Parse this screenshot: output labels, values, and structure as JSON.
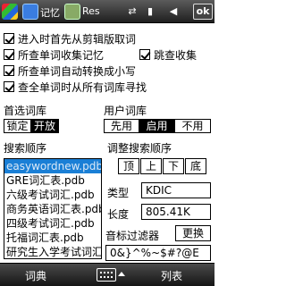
{
  "titlebar": {
    "app1_label": "记忆",
    "app2_label": "Res",
    "ok_label": "ok",
    "icons": [
      "windows-flag-icon",
      "app-icon",
      "app-icon",
      "network-icon",
      "signal-icon",
      "volume-icon"
    ],
    "colors": {
      "bar": "#2a2a2a",
      "text": "#ffffff"
    }
  },
  "options": {
    "enter_first_from_clipboard": "进入时首先从剪辑版取词",
    "record_all_lookups": "所查单词收集记忆",
    "jump_to_collection": "跳查收集",
    "auto_lowercase": "所查单词自动转换成小写",
    "search_all_dicts": "查全单词时从所有词库寻找"
  },
  "preferred_dict": {
    "label": "首选词库",
    "buttons": [
      "锁定",
      "开放"
    ],
    "selected": "开放"
  },
  "user_dict": {
    "label": "用户词库",
    "buttons": [
      "先用",
      "启用",
      "不用"
    ],
    "selected": "启用"
  },
  "search_order": {
    "label": "搜索顺序",
    "items": [
      "easywordnew.pdb",
      "GRE词汇表.pdb",
      "六级考试词汇.pdb",
      "商务英语词汇表.pdb",
      "四级考试词汇.pdb",
      "托福词汇表.pdb",
      "研究生入学考试词汇"
    ],
    "selected_index": 0,
    "colors": {
      "selected_bg": "#1a7fd6",
      "selected_text": "#dbe9f7"
    }
  },
  "adjust_order": {
    "label": "调整搜索顺序",
    "buttons": [
      "顶",
      "上",
      "下",
      "底"
    ]
  },
  "details": {
    "type_label": "类型",
    "type_value": "KDIC",
    "length_label": "长度",
    "length_value": "805.41K",
    "phonetic_filter_label": "音标过滤器",
    "update_button": "更换",
    "filter_value": "0&}^%~$#?@E"
  },
  "bottombar": {
    "left_label": "词典",
    "right_label": "列表",
    "center_icon": "keyboard-icon"
  }
}
